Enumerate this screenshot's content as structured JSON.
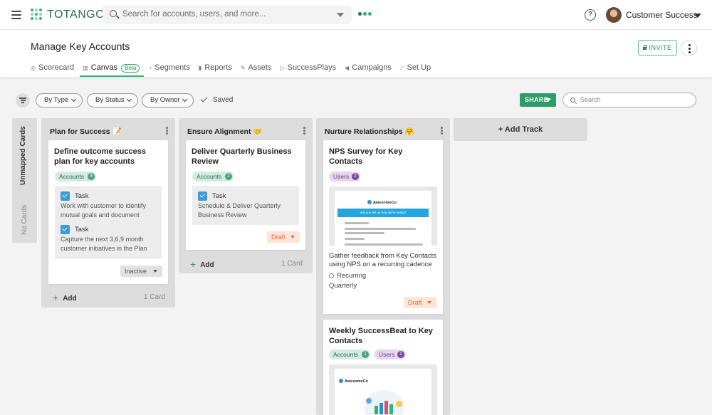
{
  "app": {
    "brand": "TOTANGO",
    "search_placeholder": "Search for accounts, users, and more...",
    "user_name": "Customer Success",
    "help_glyph": "?"
  },
  "header": {
    "title": "Manage Key Accounts",
    "invite_label": "INVITE",
    "tabs": [
      {
        "label": "Scorecard",
        "icon": "scorecard-icon",
        "active": false
      },
      {
        "label": "Canvas",
        "icon": "canvas-icon",
        "active": true,
        "badge": "Beta"
      },
      {
        "label": "Segments",
        "icon": "segments-icon",
        "active": false
      },
      {
        "label": "Reports",
        "icon": "reports-icon",
        "active": false
      },
      {
        "label": "Assets",
        "icon": "assets-icon",
        "active": false
      },
      {
        "label": "SuccessPlays",
        "icon": "play-icon",
        "active": false
      },
      {
        "label": "Campaigns",
        "icon": "megaphone-icon",
        "active": false
      },
      {
        "label": "Set Up",
        "icon": "wand-icon",
        "active": false
      }
    ]
  },
  "filters": {
    "by_type": "By Type",
    "by_status": "By Status",
    "by_owner": "By Owner",
    "saved": "Saved",
    "share_label": "SHARE",
    "search_placeholder": "Search"
  },
  "unmapped": {
    "title": "Unmapped Cards",
    "empty": "No Cards"
  },
  "tracks": [
    {
      "title": "Plan for Success 📝",
      "cards": [
        {
          "title": "Define outcome success plan for key accounts",
          "tags": [
            {
              "label": "Accounts",
              "count": "3"
            }
          ],
          "tasks": [
            {
              "name": "Task",
              "desc": "Work with customer to identify mutual goals and document"
            },
            {
              "name": "Task",
              "desc": "Capture the next 3,6,9 month customer initiatives in the Plan"
            }
          ],
          "status": "Inactive"
        }
      ],
      "add_label": "Add",
      "count_label": "1 Card"
    },
    {
      "title": "Ensure Alignment 🤝",
      "cards": [
        {
          "title": "Deliver Quarterly Business Review",
          "tags": [
            {
              "label": "Accounts",
              "count": "2"
            }
          ],
          "tasks": [
            {
              "name": "Task",
              "desc": "Schedule & Deliver Quarterly Business Review"
            }
          ],
          "status": "Draft"
        }
      ],
      "add_label": "Add",
      "count_label": "1 Card"
    },
    {
      "title": "Nurture Relationships 🤗",
      "cards": [
        {
          "title": "NPS Survey for Key Contacts",
          "tags": [
            {
              "label": "Users",
              "count": "2"
            }
          ],
          "preview_brand": "AwesomeCo",
          "preview_banner": "Will you tell us how we're doing?",
          "desc": "Gather feedback from Key Contacts using NPS on a recurring cadence",
          "recurrence": "Recurring",
          "frequency": "Quarterly",
          "status": "Draft"
        },
        {
          "title": "Weekly SuccessBeat to Key Contacts",
          "tags": [
            {
              "label": "Accounts",
              "count": "1"
            },
            {
              "label": "Users",
              "count": "1"
            }
          ],
          "preview_brand": "AwesomeCo"
        }
      ]
    }
  ],
  "add_track_label": "+ Add Track",
  "colors": {
    "brand_green": "#2bb673",
    "share_green": "#2e9b6a",
    "draft_orange": "#e8643b",
    "task_blue": "#3d9bd6"
  }
}
